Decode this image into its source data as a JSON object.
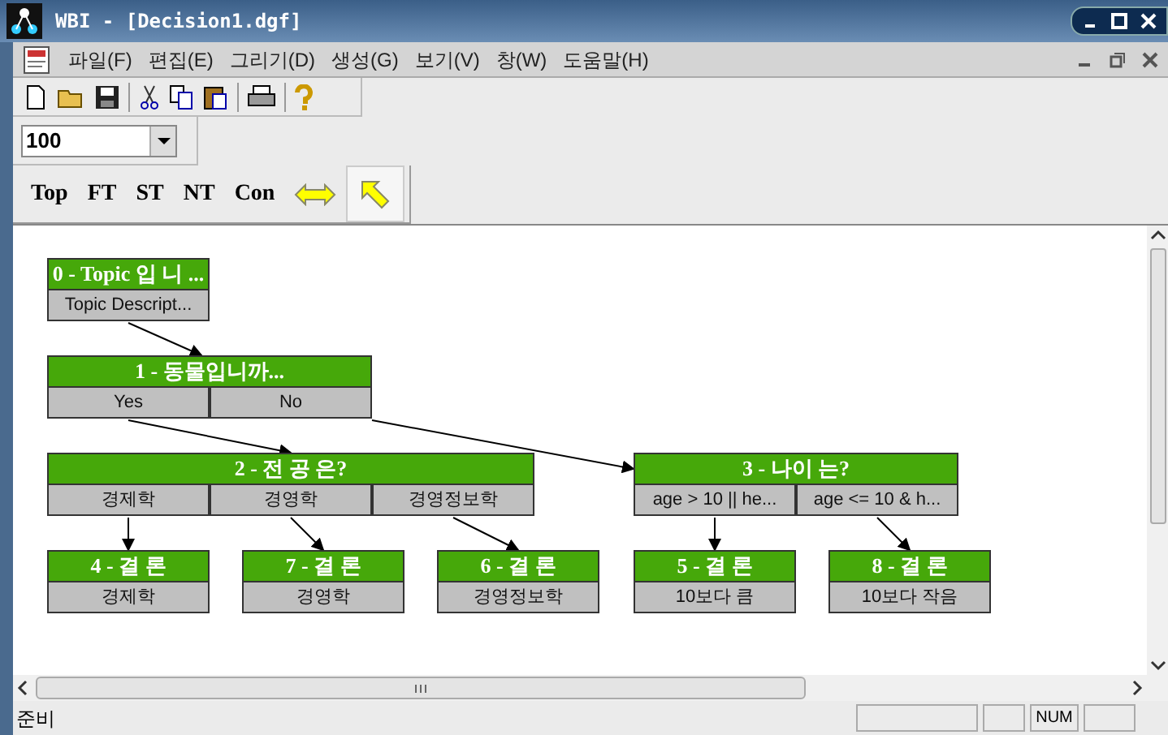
{
  "window": {
    "title": "WBI - [Decision1.dgf]"
  },
  "menu": [
    {
      "label": "파일(F)"
    },
    {
      "label": "편집(E)"
    },
    {
      "label": "그리기(D)"
    },
    {
      "label": "생성(G)"
    },
    {
      "label": "보기(V)"
    },
    {
      "label": "창(W)"
    },
    {
      "label": "도움말(H)"
    }
  ],
  "zoom": {
    "value": "100"
  },
  "draw_tools": [
    {
      "kind": "text",
      "label": "Top",
      "selected": false
    },
    {
      "kind": "text",
      "label": "FT",
      "selected": false
    },
    {
      "kind": "text",
      "label": "ST",
      "selected": false
    },
    {
      "kind": "text",
      "label": "NT",
      "selected": false
    },
    {
      "kind": "text",
      "label": "Con",
      "selected": false
    },
    {
      "kind": "connector",
      "selected": false
    },
    {
      "kind": "pointer",
      "selected": true
    }
  ],
  "nodes": [
    {
      "title": "0 - Topic 입 니 ...",
      "cells": [
        "Topic Descript..."
      ]
    },
    {
      "title": "1 - 동물입니까...",
      "cells": [
        "Yes",
        "No"
      ]
    },
    {
      "title": "2 - 전 공 은?",
      "cells": [
        "경제학",
        "경영학",
        "경영정보학"
      ]
    },
    {
      "title": "3 - 나이 는?",
      "cells": [
        "age > 10 || he...",
        "age <= 10 & h..."
      ]
    },
    {
      "title": "4 - 결 론",
      "cells": [
        "경제학"
      ]
    },
    {
      "title": "7 - 결 론",
      "cells": [
        "경영학"
      ]
    },
    {
      "title": "6 - 결 론",
      "cells": [
        "경영정보학"
      ]
    },
    {
      "title": "5 - 결 론",
      "cells": [
        "10보다 큼"
      ]
    },
    {
      "title": "8 - 결 론",
      "cells": [
        "10보다 작음"
      ]
    }
  ],
  "status_bar": {
    "message": "준비",
    "num": "NUM"
  }
}
